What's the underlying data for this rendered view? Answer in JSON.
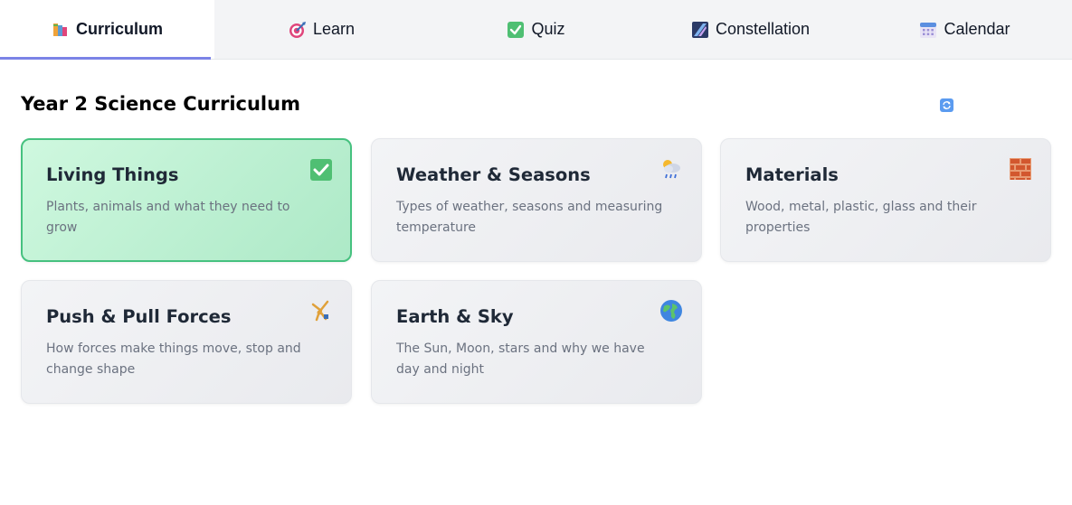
{
  "tabs": [
    {
      "label": "Curriculum",
      "icon": "books-icon",
      "active": true
    },
    {
      "label": "Learn",
      "icon": "target-icon",
      "active": false
    },
    {
      "label": "Quiz",
      "icon": "check-box-icon",
      "active": false
    },
    {
      "label": "Constellation",
      "icon": "stars-icon",
      "active": false
    },
    {
      "label": "Calendar",
      "icon": "calendar-icon",
      "active": false
    }
  ],
  "page": {
    "title": "Year 2 Science Curriculum",
    "refresh_icon": "refresh-icon"
  },
  "colors": {
    "accent": "#7b83e6",
    "done_border": "#46c17f",
    "done_fill": "#c6f5da",
    "card_fill": "#eeeff2"
  },
  "topics": [
    {
      "title": "Living Things",
      "description": "Plants, animals and what they need to grow",
      "icon": "check-mark-icon",
      "completed": true
    },
    {
      "title": "Weather & Seasons",
      "description": "Types of weather, seasons and measuring temperature",
      "icon": "rain-cloud-icon",
      "completed": false
    },
    {
      "title": "Materials",
      "description": "Wood, metal, plastic, glass and their properties",
      "icon": "brick-icon",
      "completed": false
    },
    {
      "title": "Push & Pull Forces",
      "description": "How forces make things move, stop and change shape",
      "icon": "cartwheel-icon",
      "completed": false
    },
    {
      "title": "Earth & Sky",
      "description": "The Sun, Moon, stars and why we have day and night",
      "icon": "globe-icon",
      "completed": false
    }
  ]
}
